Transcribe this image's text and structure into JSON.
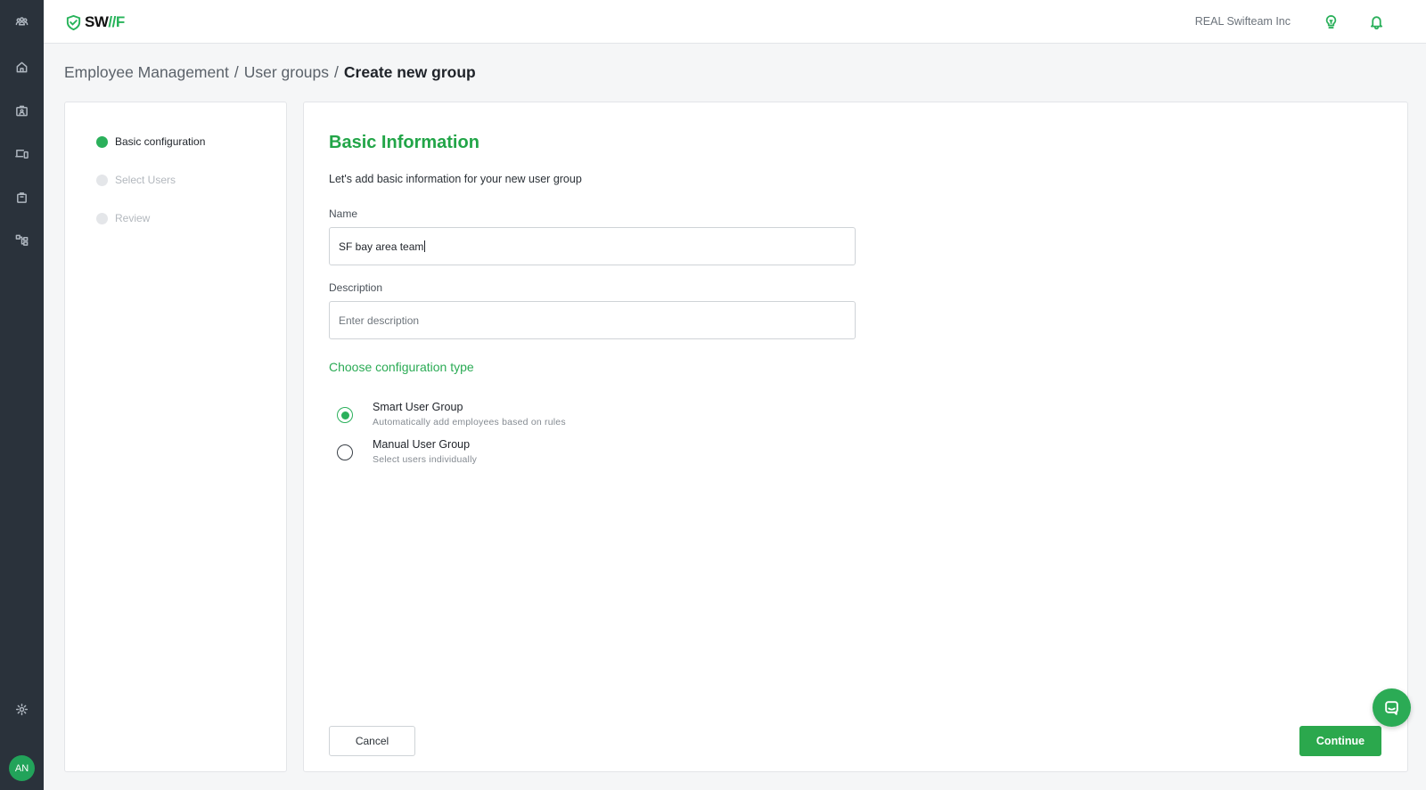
{
  "app": {
    "logo_text": "SW",
    "logo_accent": "//F",
    "company": "REAL Swifteam Inc",
    "user_initials": "AN",
    "accent_color": "#2bb05b",
    "rail_color": "#2a323b"
  },
  "rail": {
    "items": [
      {
        "name": "team-icon"
      },
      {
        "name": "home-icon"
      },
      {
        "name": "id-badge-icon"
      },
      {
        "name": "devices-icon"
      },
      {
        "name": "bag-icon"
      },
      {
        "name": "workflow-icon"
      },
      {
        "name": "settings-icon"
      }
    ]
  },
  "header": {
    "icons": [
      "lightbulb-icon",
      "bell-icon"
    ]
  },
  "breadcrumb": {
    "items": [
      "Employee Management",
      "User groups",
      "Create new group"
    ],
    "separator": "/"
  },
  "stepper": {
    "steps": [
      {
        "label": "Basic configuration",
        "active": true
      },
      {
        "label": "Select Users",
        "active": false
      },
      {
        "label": "Review",
        "active": false
      }
    ]
  },
  "form": {
    "title": "Basic Information",
    "subtitle": "Let's add basic information for your new user group",
    "name_label": "Name",
    "name_value": "SF bay area team",
    "description_label": "Description",
    "description_placeholder": "Enter description",
    "config_title": "Choose configuration type",
    "options": [
      {
        "title": "Smart User Group",
        "desc": "Automatically add employees based on rules",
        "checked": true
      },
      {
        "title": "Manual User Group",
        "desc": "Select users individually",
        "checked": false
      }
    ],
    "cancel_label": "Cancel",
    "continue_label": "Continue"
  }
}
